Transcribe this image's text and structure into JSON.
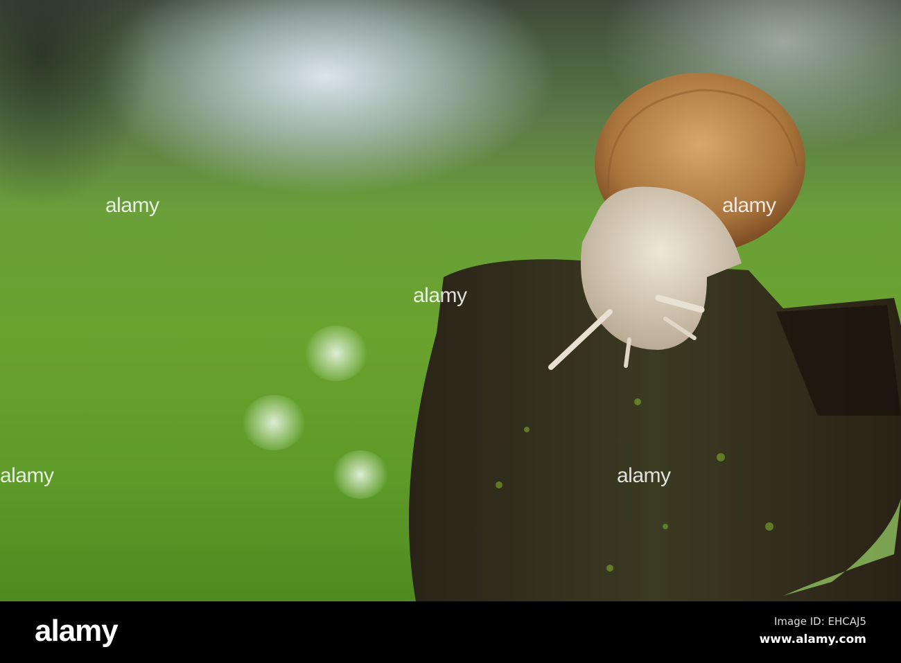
{
  "watermark": {
    "text": "alamy"
  },
  "footer": {
    "logo": "alamy",
    "image_id": "Image ID: EHCAJ5",
    "website": "www.alamy.com"
  }
}
